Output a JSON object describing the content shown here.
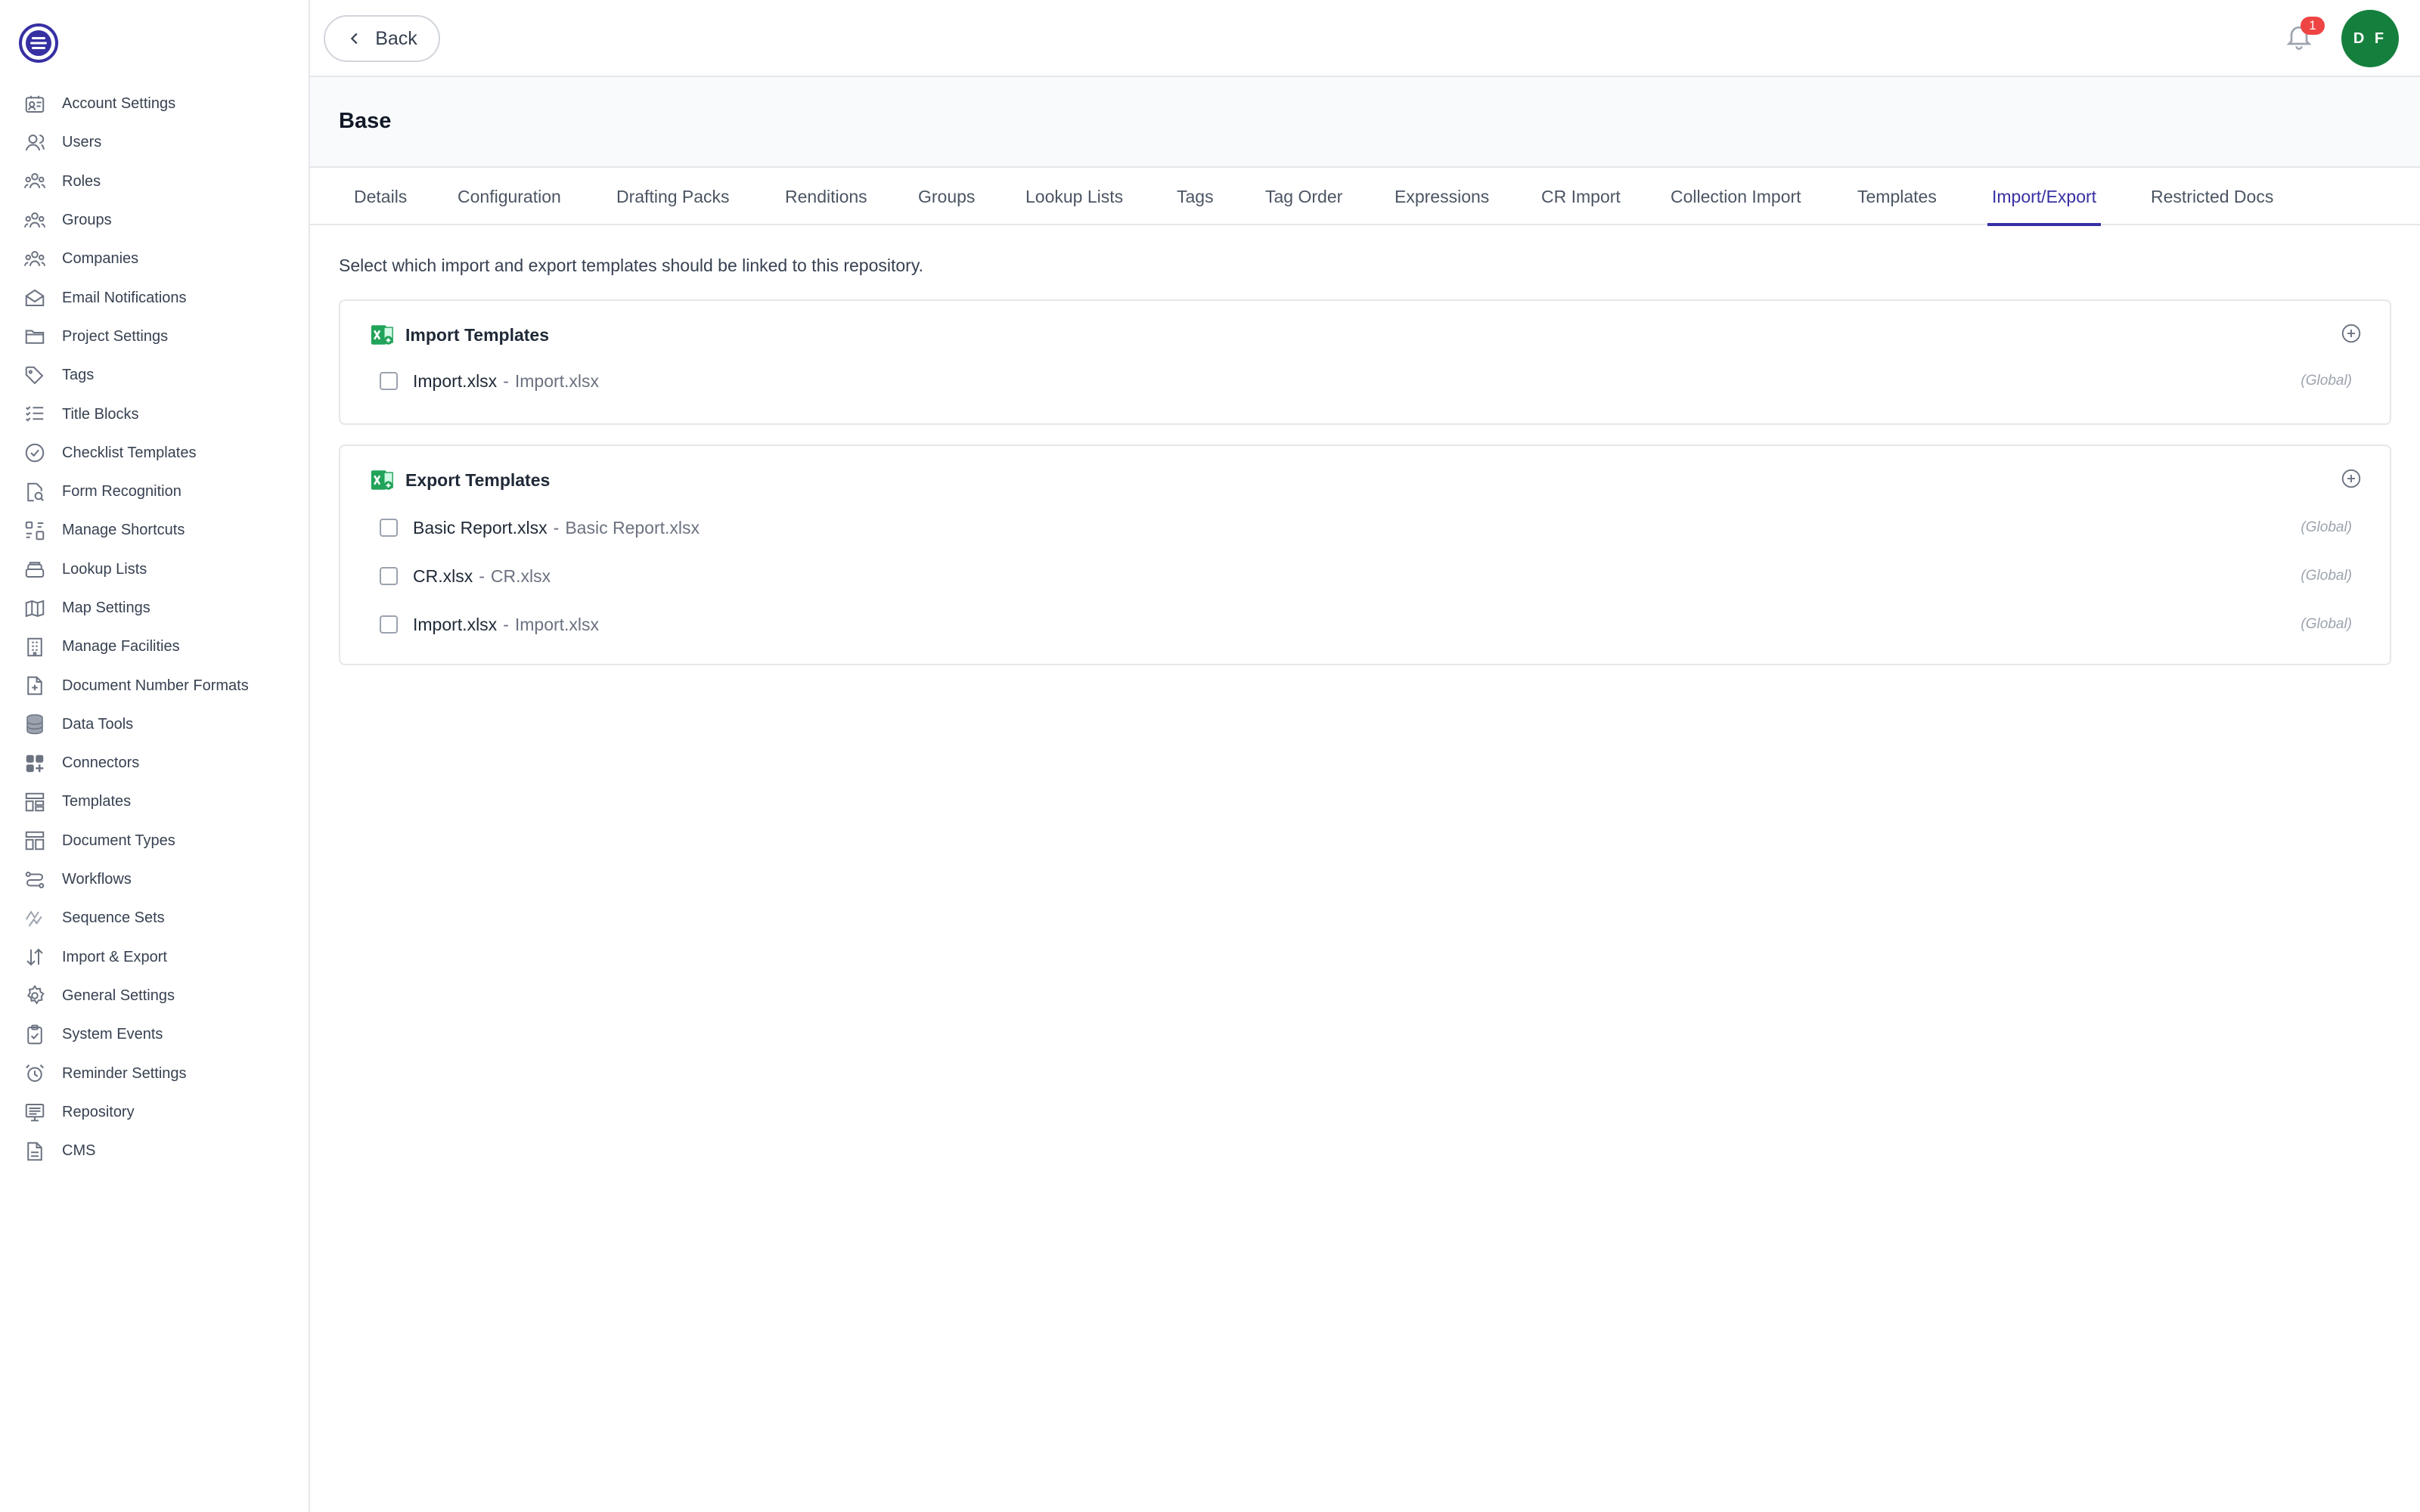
{
  "sidebar": {
    "items": [
      {
        "label": "Account Settings",
        "icon": "account-card-icon"
      },
      {
        "label": "Users",
        "icon": "user-icon"
      },
      {
        "label": "Roles",
        "icon": "users-icon"
      },
      {
        "label": "Groups",
        "icon": "group-icon"
      },
      {
        "label": "Companies",
        "icon": "companies-icon"
      },
      {
        "label": "Email Notifications",
        "icon": "envelope-icon"
      },
      {
        "label": "Project Settings",
        "icon": "folder-icon"
      },
      {
        "label": "Tags",
        "icon": "tag-icon"
      },
      {
        "label": "Title Blocks",
        "icon": "list-check-icon"
      },
      {
        "label": "Checklist Templates",
        "icon": "check-circle-icon"
      },
      {
        "label": "Form Recognition",
        "icon": "doc-search-icon"
      },
      {
        "label": "Manage Shortcuts",
        "icon": "shortcut-icon"
      },
      {
        "label": "Lookup Lists",
        "icon": "stack-icon"
      },
      {
        "label": "Map Settings",
        "icon": "map-icon"
      },
      {
        "label": "Manage Facilities",
        "icon": "building-icon"
      },
      {
        "label": "Document Number Formats",
        "icon": "doc-plus-icon"
      },
      {
        "label": "Data Tools",
        "icon": "database-icon"
      },
      {
        "label": "Connectors",
        "icon": "grid-plus-icon"
      },
      {
        "label": "Templates",
        "icon": "template-icon"
      },
      {
        "label": "Document Types",
        "icon": "doc-type-icon"
      },
      {
        "label": "Workflows",
        "icon": "workflow-icon"
      },
      {
        "label": "Sequence Sets",
        "icon": "sequence-icon"
      },
      {
        "label": "Import & Export",
        "icon": "arrows-up-down-icon"
      },
      {
        "label": "General Settings",
        "icon": "gear-icon"
      },
      {
        "label": "System Events",
        "icon": "clipboard-check-icon"
      },
      {
        "label": "Reminder Settings",
        "icon": "alarm-icon"
      },
      {
        "label": "Repository",
        "icon": "monitor-icon"
      },
      {
        "label": "CMS",
        "icon": "file-icon"
      }
    ]
  },
  "topbar": {
    "back_label": "Back",
    "notification_count": "1",
    "avatar_initials": "D F"
  },
  "page": {
    "title": "Base"
  },
  "tabs": [
    {
      "label": "Details"
    },
    {
      "label": "Configuration"
    },
    {
      "label": "Drafting Packs"
    },
    {
      "label": "Renditions"
    },
    {
      "label": "Groups"
    },
    {
      "label": "Lookup Lists"
    },
    {
      "label": "Tags"
    },
    {
      "label": "Tag Order"
    },
    {
      "label": "Expressions"
    },
    {
      "label": "CR Import"
    },
    {
      "label": "Collection Import"
    },
    {
      "label": "Templates"
    },
    {
      "label": "Import/Export",
      "active": true
    },
    {
      "label": "Restricted Docs"
    }
  ],
  "main": {
    "intro": "Select which import and export templates should be linked to this repository.",
    "import_section": {
      "title": "Import Templates",
      "rows": [
        {
          "name": "Import.xlsx",
          "separator": "-",
          "file": "Import.xlsx",
          "scope": "(Global)"
        }
      ]
    },
    "export_section": {
      "title": "Export Templates",
      "rows": [
        {
          "name": "Basic Report.xlsx",
          "separator": "-",
          "file": "Basic Report.xlsx",
          "scope": "(Global)"
        },
        {
          "name": "CR.xlsx",
          "separator": "-",
          "file": "CR.xlsx",
          "scope": "(Global)"
        },
        {
          "name": "Import.xlsx",
          "separator": "-",
          "file": "Import.xlsx",
          "scope": "(Global)"
        }
      ]
    }
  },
  "colors": {
    "accent": "#3730a3",
    "avatar_bg": "#15803d",
    "badge_bg": "#ef4444",
    "excel_green": "#22a35a"
  }
}
